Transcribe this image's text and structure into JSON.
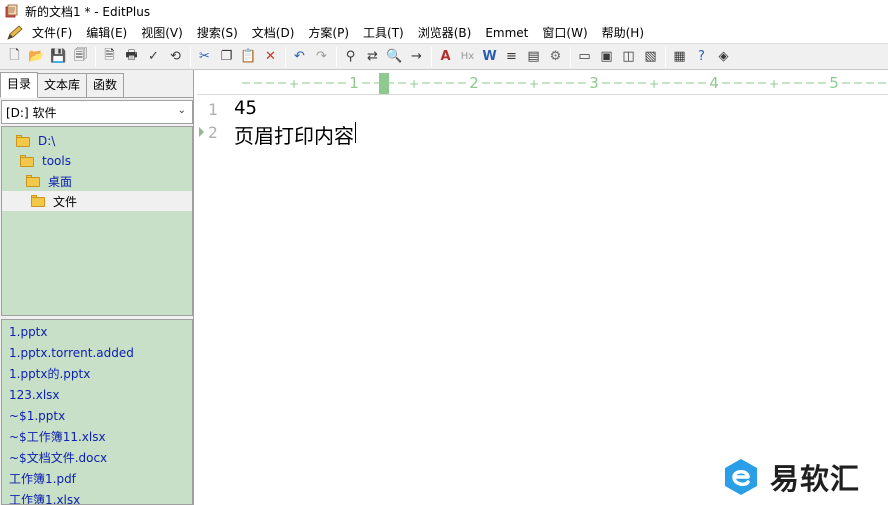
{
  "window": {
    "title": "新的文档1 * - EditPlus"
  },
  "menu": [
    "文件(F)",
    "编辑(E)",
    "视图(V)",
    "搜索(S)",
    "文档(D)",
    "方案(P)",
    "工具(T)",
    "浏览器(B)",
    "Emmet",
    "窗口(W)",
    "帮助(H)"
  ],
  "toolbar_icons": [
    "new-icon",
    "open-icon",
    "save-icon",
    "save-all-icon",
    "sep",
    "print-preview-icon",
    "print-icon",
    "spell-check-icon",
    "html-preview-icon",
    "sep",
    "cut-icon",
    "copy-icon",
    "paste-icon",
    "delete-icon",
    "sep",
    "undo-icon",
    "redo-icon",
    "sep",
    "find-icon",
    "replace-icon",
    "find-in-files-icon",
    "go-to-icon",
    "sep",
    "font-icon",
    "hx-icon",
    "word-wrap-icon",
    "line-icon",
    "column-icon",
    "settings-icon",
    "sep",
    "window-1-icon",
    "window-2-icon",
    "window-3-icon",
    "window-4-icon",
    "sep",
    "tool-1-icon",
    "help-icon",
    "tool-2-icon"
  ],
  "left_panel": {
    "tabs": [
      "目录",
      "文本库",
      "函数"
    ],
    "active_tab": 0,
    "drive": "[D:] 软件",
    "directories": [
      {
        "name": "D:\\",
        "indent": 0
      },
      {
        "name": "tools",
        "indent": 1
      },
      {
        "name": "桌面",
        "indent": 2
      },
      {
        "name": "文件",
        "indent": 3,
        "selected": true
      }
    ],
    "files": [
      "1.pptx",
      "1.pptx.torrent.added",
      "1.pptx的.pptx",
      "123.xlsx",
      "~$1.pptx",
      "~$工作簿11.xlsx",
      "~$文档文件.docx",
      "工作簿1.pdf",
      "工作簿1.xlsx"
    ]
  },
  "ruler": {
    "labels": [
      "1",
      "2",
      "3",
      "4",
      "5"
    ]
  },
  "editor": {
    "lines": [
      {
        "number": "1",
        "text": "45"
      },
      {
        "number": "2",
        "text": "页眉打印内容"
      }
    ]
  },
  "watermark": {
    "brand": "易软汇",
    "colors": {
      "logo": "#2a9ee6"
    }
  },
  "colors": {
    "panel_green": "#c7e0c7",
    "file_text": "#1020b0",
    "ruler_green": "#8fc98f"
  }
}
